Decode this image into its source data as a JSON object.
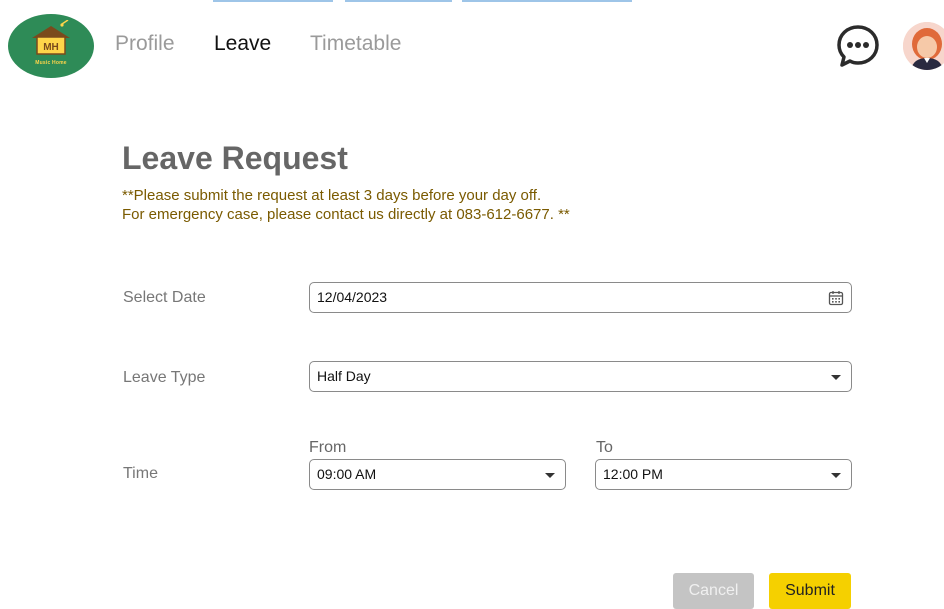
{
  "header": {
    "logo_text": "MH",
    "logo_subtext": "Music Home",
    "nav": [
      {
        "label": "Profile",
        "active": false
      },
      {
        "label": "Leave",
        "active": true
      },
      {
        "label": "Timetable",
        "active": false
      }
    ],
    "chat_icon": "chat-bubble-icon",
    "avatar_icon": "user-avatar-icon"
  },
  "page": {
    "title": "Leave Request",
    "notice_line1": "**Please submit the request at least 3 days before your day off.",
    "notice_line2": "For emergency case, please contact us directly at 083-612-6677. **"
  },
  "form": {
    "date_label": "Select Date",
    "date_value": "12/04/2023",
    "leave_type_label": "Leave Type",
    "leave_type_value": "Half Day",
    "time_label": "Time",
    "from_label": "From",
    "from_value": "09:00 AM",
    "to_label": "To",
    "to_value": "12:00 PM"
  },
  "actions": {
    "cancel_label": "Cancel",
    "submit_label": "Submit"
  },
  "colors": {
    "logo_bg": "#2e8b57",
    "notice_text": "#7a5a00",
    "submit_bg": "#f5d000",
    "cancel_bg": "#c4c4c4"
  }
}
